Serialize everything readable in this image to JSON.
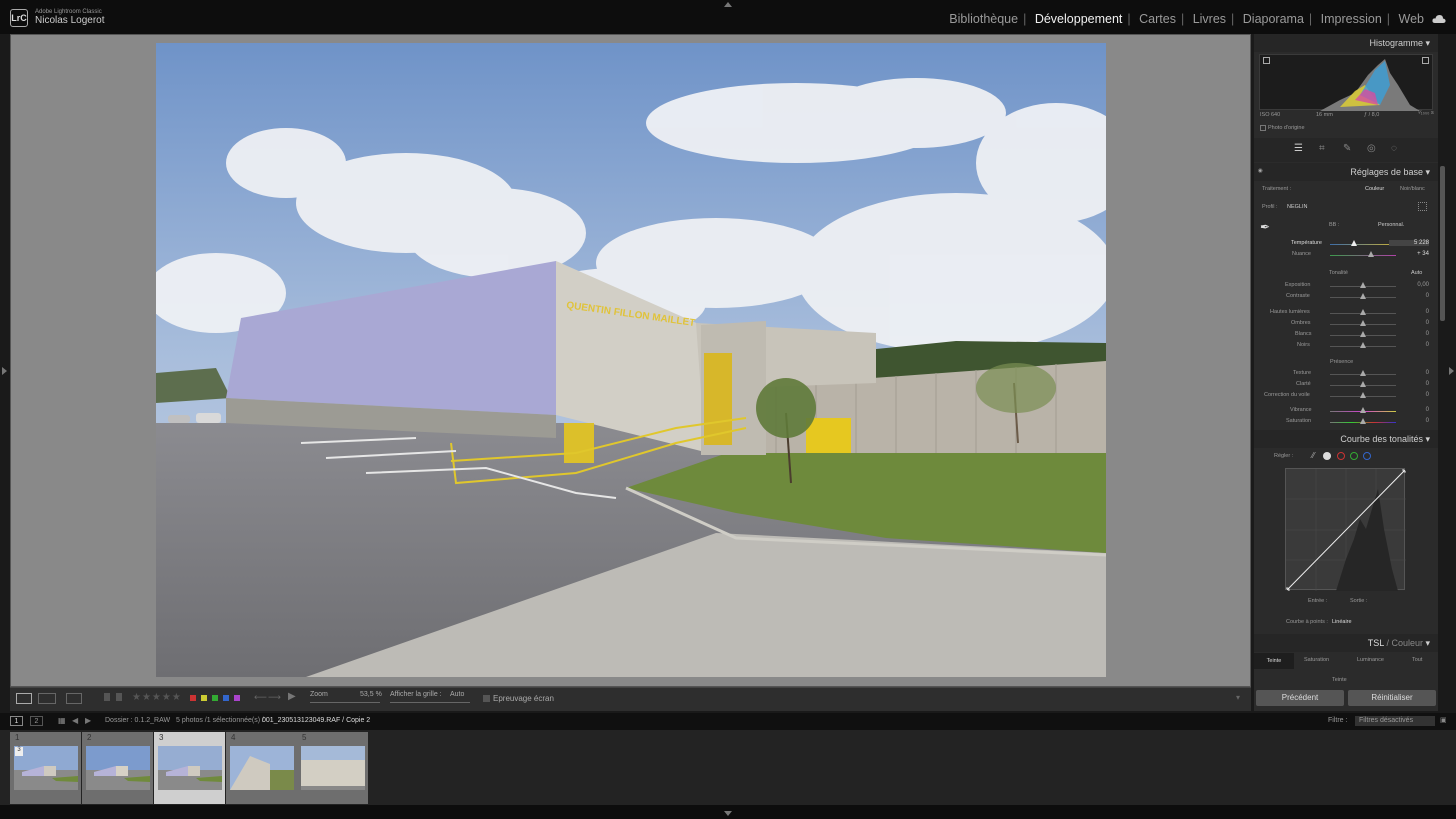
{
  "app": {
    "name": "Adobe Lightroom Classic",
    "user": "Nicolas Logerot",
    "logo": "LrC"
  },
  "modules": [
    {
      "label": "Bibliothèque",
      "active": false
    },
    {
      "label": "Développement",
      "active": true
    },
    {
      "label": "Cartes",
      "active": false
    },
    {
      "label": "Livres",
      "active": false
    },
    {
      "label": "Diaporama",
      "active": false
    },
    {
      "label": "Impression",
      "active": false
    },
    {
      "label": "Web",
      "active": false
    }
  ],
  "photo": {
    "sign_text": "QUENTIN FILLON MAILLET"
  },
  "toolbar": {
    "zoom_label": "Zoom",
    "zoom_value": "53,5 %",
    "grid_label": "Afficher la grille :",
    "grid_value": "Auto",
    "softproof_label": "Epreuvage écran"
  },
  "histogram": {
    "title": "Histogramme",
    "iso": "ISO 640",
    "focal": "16 mm",
    "aperture": "ƒ / 8,0",
    "shutter": "¹⁄₁₀₀₀ s",
    "original_label": "Photo d'origine"
  },
  "basic": {
    "title": "Réglages de base",
    "treatment_label": "Traitement :",
    "treatment_color": "Couleur",
    "treatment_bw": "Noir/blanc",
    "profile_label": "Profil :",
    "profile_value": "NEGLIN",
    "wb_label": "BB :",
    "wb_value": "Personnal.",
    "sliders": {
      "temperature": {
        "label": "Température",
        "value": "5 228"
      },
      "tint": {
        "label": "Nuance",
        "value": "+ 34"
      },
      "tone_label": "Tonalité",
      "auto_label": "Auto",
      "exposure": {
        "label": "Exposition",
        "value": "0,00"
      },
      "contrast": {
        "label": "Contraste",
        "value": "0"
      },
      "highlights": {
        "label": "Hautes lumières",
        "value": "0"
      },
      "shadows": {
        "label": "Ombres",
        "value": "0"
      },
      "whites": {
        "label": "Blancs",
        "value": "0"
      },
      "blacks": {
        "label": "Noirs",
        "value": "0"
      },
      "presence_label": "Présence",
      "texture": {
        "label": "Texture",
        "value": "0"
      },
      "clarity": {
        "label": "Clarté",
        "value": "0"
      },
      "dehaze": {
        "label": "Correction du voile",
        "value": "0"
      },
      "vibrance": {
        "label": "Vibrance",
        "value": "0"
      },
      "saturation": {
        "label": "Saturation",
        "value": "0"
      }
    }
  },
  "curve": {
    "title": "Courbe des tonalités",
    "adjust_label": "Régler :",
    "input_label": "Entrée :",
    "output_label": "Sortie :",
    "point_curve_label": "Courbe à points :",
    "point_curve_value": "Linéaire"
  },
  "hsl": {
    "title_tsl": "TSL",
    "title_color": " / Couleur",
    "tabs": [
      "Teinte",
      "Saturation",
      "Luminance",
      "Tout"
    ],
    "sub_label": "Teinte"
  },
  "buttons": {
    "previous": "Précédent",
    "reset": "Réinitialiser"
  },
  "filmnav": {
    "screen1": "1",
    "screen2": "2",
    "folder": "Dossier : 0.1.2_RAW",
    "info": "5 photos /1 sélectionnée(s) /",
    "file": "001_230513123049.RAF / Copie 2",
    "filter_label": "Filtre :",
    "filter_value": "Filtres désactivés"
  },
  "filmstrip": [
    {
      "num": "1",
      "badge": "3"
    },
    {
      "num": "2",
      "badge": ""
    },
    {
      "num": "3",
      "badge": ""
    },
    {
      "num": "4",
      "badge": ""
    },
    {
      "num": "5",
      "badge": ""
    }
  ],
  "colors": {
    "accent": "#f0f0f0",
    "panel": "#2b2b2b",
    "bg": "#898989"
  }
}
